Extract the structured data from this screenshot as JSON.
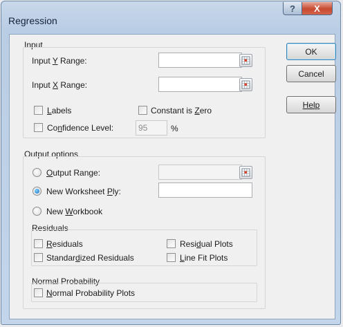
{
  "window": {
    "title": "Regression",
    "help_glyph": "?",
    "close_glyph": "X"
  },
  "buttons": {
    "ok": "OK",
    "cancel": "Cancel",
    "help": "Help"
  },
  "input_group": {
    "title": "Input",
    "y_range": {
      "label_before": "Input ",
      "mnemonic": "Y",
      "label_after": " Range:",
      "value": ""
    },
    "x_range": {
      "label_before": "Input ",
      "mnemonic": "X",
      "label_after": " Range:",
      "value": ""
    },
    "labels": {
      "mnemonic": "L",
      "rest": "abels",
      "checked": false
    },
    "constant_zero": {
      "label_before": "Constant is ",
      "mnemonic": "Z",
      "label_after": "ero",
      "checked": false
    },
    "confidence": {
      "label_before": "Co",
      "mnemonic": "n",
      "label_after": "fidence Level:",
      "value": "95",
      "unit": "%",
      "checked": false
    }
  },
  "output_group": {
    "title": "Output options",
    "output_range": {
      "mnemonic": "O",
      "rest": "utput Range:",
      "selected": false,
      "value": ""
    },
    "new_ply": {
      "label_before": "New Worksheet ",
      "mnemonic": "P",
      "label_after": "ly:",
      "selected": true,
      "value": ""
    },
    "new_workbook": {
      "label_before": "New ",
      "mnemonic": "W",
      "label_after": "orkbook",
      "selected": false
    }
  },
  "residuals_group": {
    "title": "Residuals",
    "residuals": {
      "mnemonic": "R",
      "rest": "esiduals",
      "checked": false
    },
    "standardized": {
      "label_before": "Standar",
      "mnemonic": "d",
      "label_after": "ized Residuals",
      "checked": false
    },
    "residual_plots": {
      "label_before": "Resi",
      "mnemonic": "d",
      "label_after": "ual Plots",
      "checked": false
    },
    "line_fit": {
      "mnemonic": "L",
      "rest": "ine Fit Plots",
      "checked": false
    }
  },
  "normal_group": {
    "title": "Normal Probability",
    "normal_plots": {
      "mnemonic": "N",
      "rest": "ormal Probability Plots",
      "checked": false
    }
  },
  "colors": {
    "accent": "#1a6fc0",
    "close": "#c74a31"
  }
}
